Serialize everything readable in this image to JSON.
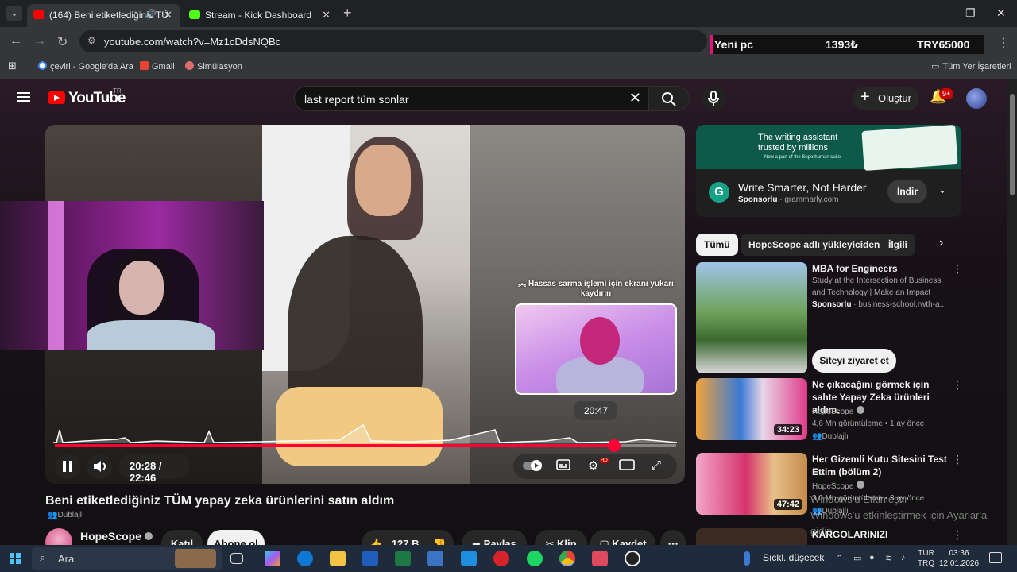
{
  "browser": {
    "tabs": [
      {
        "title": "(164) Beni etiketlediğiniz TÜ",
        "favicon_color": "#ff0000"
      },
      {
        "title": "Stream - Kick Dashboard",
        "favicon_color": "#53fc18"
      }
    ],
    "url": "youtube.com/watch?v=Mz1cDdsNQBc",
    "ticker": {
      "label": "Yeni pc",
      "price": "1393₺",
      "goal": "TRY65000"
    },
    "bookmarks": [
      {
        "label": "çeviri - Google'da Ara",
        "icon": "google-icon"
      },
      {
        "label": "Gmail",
        "icon": "gmail-icon"
      },
      {
        "label": "Simülasyon",
        "icon": "bookmark-icon"
      }
    ],
    "all_bookmarks": "Tüm Yer İşaretleri"
  },
  "youtube": {
    "logo_text": "YouTube",
    "country": "TR",
    "search_query": "last report tüm sonlar",
    "create_label": "Oluştur",
    "notification_count": "9+"
  },
  "player": {
    "hint": "Hassas sarma işlemi için ekranı yukarı kaydırın",
    "preview_time": "20:47",
    "current_time": "20:28 / 22:46",
    "progress": 0.9,
    "accent": "#ff0033"
  },
  "video": {
    "title": "Beni etiketlediğiniz TÜM yapay zeka ürünlerini satın aldım",
    "dub_label": "Dublajlı",
    "channel": "HopeScope",
    "join_label": "Katıl",
    "subscribe_label": "Abone ol",
    "likes": "127 B",
    "share_label": "Paylaş",
    "clip_label": "Klip",
    "save_label": "Kaydet"
  },
  "ad": {
    "banner_text_1": "The writing assistant",
    "banner_text_2": "trusted by millions",
    "banner_small": "Now a part of the Superhuman suite",
    "title": "Write Smarter, Not Harder",
    "sponsored": "Sponsorlu",
    "domain": "grammarly.com",
    "install_label": "İndir"
  },
  "chips": [
    "Tümü",
    "HopeScope adlı yükleyiciden",
    "İlgili"
  ],
  "recommendations": [
    {
      "title": "MBA for Engineers",
      "line1": "Study at the Intersection of Business",
      "line2": "and Technology | Make an Impact",
      "sponsored": "Sponsorlu",
      "domain": "· business-school.rwth-a...",
      "cta": "Siteyi ziyaret et"
    },
    {
      "title": "Ne çıkacağını görmek için sahte Yapay Zeka ürünleri aldım.",
      "channel": "HopeScope",
      "stats": "4,6 Mn görüntüleme • 1 ay önce",
      "badge": "Dublajlı",
      "duration": "34:23"
    },
    {
      "title": "Her Gizemli Kutu Sitesini Test Ettim (bölüm 2)",
      "channel": "HopeScope",
      "stats": "3,0 Mn görüntüleme • 3 ay önce",
      "badge": "Dublajlı",
      "duration": "47:42"
    },
    {
      "title": "KARGOLARINIZI"
    }
  ],
  "watermark": {
    "line1": "Windows'u Etkinleştir",
    "line2": "Windows'u etkinleştirmek için Ayarlar'a gidin."
  },
  "taskbar": {
    "search_placeholder": "Ara",
    "weather": "Sıckl. düşecek",
    "lang_1": "TUR",
    "lang_2": "TRQ",
    "time": "03:36",
    "date": "12.01.2026"
  }
}
